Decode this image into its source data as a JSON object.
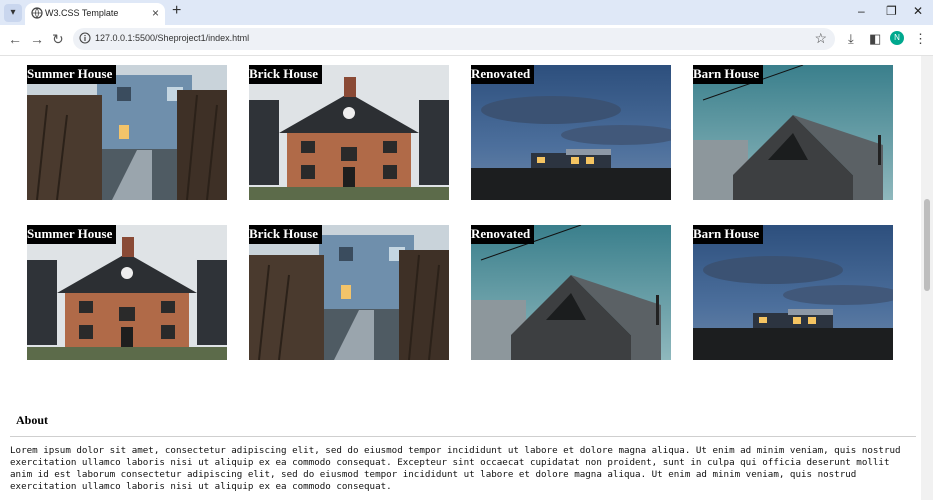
{
  "browser": {
    "tab_title": "W3.CSS Template",
    "url": "127.0.0.1:5500/Sheproject1/index.html",
    "profile_initial": "N"
  },
  "gallery": {
    "rows": [
      [
        {
          "label": "Summer House",
          "image": "blue-house"
        },
        {
          "label": "Brick House",
          "image": "brick-house"
        },
        {
          "label": "Renovated",
          "image": "night-house"
        },
        {
          "label": "Barn House",
          "image": "barn-house"
        }
      ],
      [
        {
          "label": "Summer House",
          "image": "brick-house"
        },
        {
          "label": "Brick House",
          "image": "blue-house"
        },
        {
          "label": "Renovated",
          "image": "barn-house"
        },
        {
          "label": "Barn House",
          "image": "night-house"
        }
      ]
    ]
  },
  "about": {
    "title": "About",
    "text": "Lorem ipsum dolor sit amet, consectetur adipiscing elit, sed do eiusmod tempor incididunt ut labore et dolore magna aliqua. Ut enim ad minim veniam, quis nostrud exercitation ullamco laboris nisi ut aliquip ex ea commodo consequat. Excepteur sint occaecat cupidatat non proident, sunt in culpa qui officia deserunt mollit anim id est laborum consectetur adipiscing elit, sed do eiusmod tempor incididunt ut labore et dolore magna aliqua. Ut enim ad minim veniam, quis nostrud exercitation ullamco laboris nisi ut aliquip ex ea commodo consequat."
  }
}
